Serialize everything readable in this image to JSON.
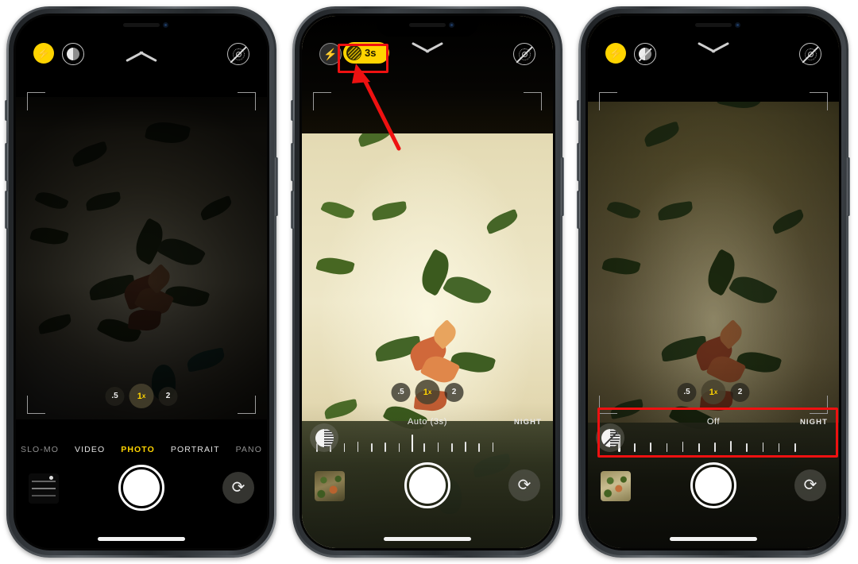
{
  "meta": {
    "scene": "iPhone Camera app Night mode tutorial, three phone screenshots side by side",
    "accent_yellow": "#ffd400",
    "annotation_red": "#ee1111"
  },
  "phones": [
    {
      "id": "phone-1",
      "caption_state": "Photo mode, Night mode icon available",
      "topbar": {
        "flash": {
          "icon": "flash-icon",
          "state": "on",
          "glyph": "⚡"
        },
        "night_toggle": {
          "icon": "night-mode-icon",
          "state": "available",
          "label": ""
        },
        "chevron": {
          "icon": "chevron-up-icon",
          "direction": "up"
        },
        "live_photo": {
          "icon": "live-photo-off-icon",
          "state": "off"
        }
      },
      "zoom_controls": {
        "options": [
          ".5",
          "1",
          "2"
        ],
        "selected": "1",
        "selected_suffix": "x"
      },
      "modes": {
        "items": [
          "SLO-MO",
          "VIDEO",
          "PHOTO",
          "PORTRAIT",
          "PANO"
        ],
        "active": "PHOTO"
      },
      "night_slider": null,
      "shutter": {
        "name": "shutter-button"
      },
      "flip": {
        "icon": "camera-flip-icon",
        "glyph": "⟳"
      },
      "thumbnail": {
        "type": "text-photo",
        "lines": [
          "everything",
          "at once",
          "records"
        ]
      }
    },
    {
      "id": "phone-2",
      "caption_state": "Night mode engaged, Auto 3 second exposure",
      "topbar": {
        "flash": {
          "icon": "flash-icon",
          "state": "off",
          "glyph": "⚡"
        },
        "night_badge": {
          "icon": "night-mode-icon",
          "label": "3s",
          "state": "active"
        },
        "chevron": {
          "icon": "chevron-down-icon",
          "direction": "down"
        },
        "live_photo": {
          "icon": "live-photo-off-icon",
          "state": "off"
        }
      },
      "zoom_controls": {
        "options": [
          ".5",
          "1",
          "2"
        ],
        "selected": "1",
        "selected_suffix": "x"
      },
      "modes": null,
      "night_slider": {
        "label": "Auto (3s)",
        "end_label": "NIGHT",
        "handle_position_percent": 50,
        "tick_count": 13,
        "toggle_icon": "night-mode-toggle-icon",
        "toggle_state": "on"
      },
      "shutter": {
        "name": "shutter-button"
      },
      "flip": {
        "icon": "camera-flip-icon",
        "glyph": "⟳"
      },
      "thumbnail": {
        "type": "carpet-photo",
        "lines": []
      }
    },
    {
      "id": "phone-3",
      "caption_state": "Night mode turned Off via slider",
      "topbar": {
        "flash": {
          "icon": "flash-icon",
          "state": "on",
          "glyph": "⚡"
        },
        "night_toggle": {
          "icon": "night-mode-off-icon",
          "state": "off",
          "label": ""
        },
        "chevron": {
          "icon": "chevron-down-icon",
          "direction": "down"
        },
        "live_photo": {
          "icon": "live-photo-off-icon",
          "state": "off"
        }
      },
      "zoom_controls": {
        "options": [
          ".5",
          "1",
          "2"
        ],
        "selected": "1",
        "selected_suffix": "x"
      },
      "modes": null,
      "night_slider": {
        "label": "Off",
        "end_label": "NIGHT",
        "handle_position_percent": 22,
        "tick_count": 11,
        "toggle_icon": "night-mode-toggle-off-icon",
        "toggle_state": "off"
      },
      "shutter": {
        "name": "shutter-button"
      },
      "flip": {
        "icon": "camera-flip-icon",
        "glyph": "⟳"
      },
      "thumbnail": {
        "type": "carpet-photo",
        "lines": []
      }
    }
  ],
  "annotations": [
    {
      "name": "highlight-night-badge",
      "type": "box",
      "target": "phone-2 night mode 3s badge"
    },
    {
      "name": "pointer-arrow",
      "type": "arrow",
      "target": "phone-2 night mode 3s badge"
    },
    {
      "name": "highlight-night-slider",
      "type": "box",
      "target": "phone-3 night mode slider row"
    }
  ]
}
